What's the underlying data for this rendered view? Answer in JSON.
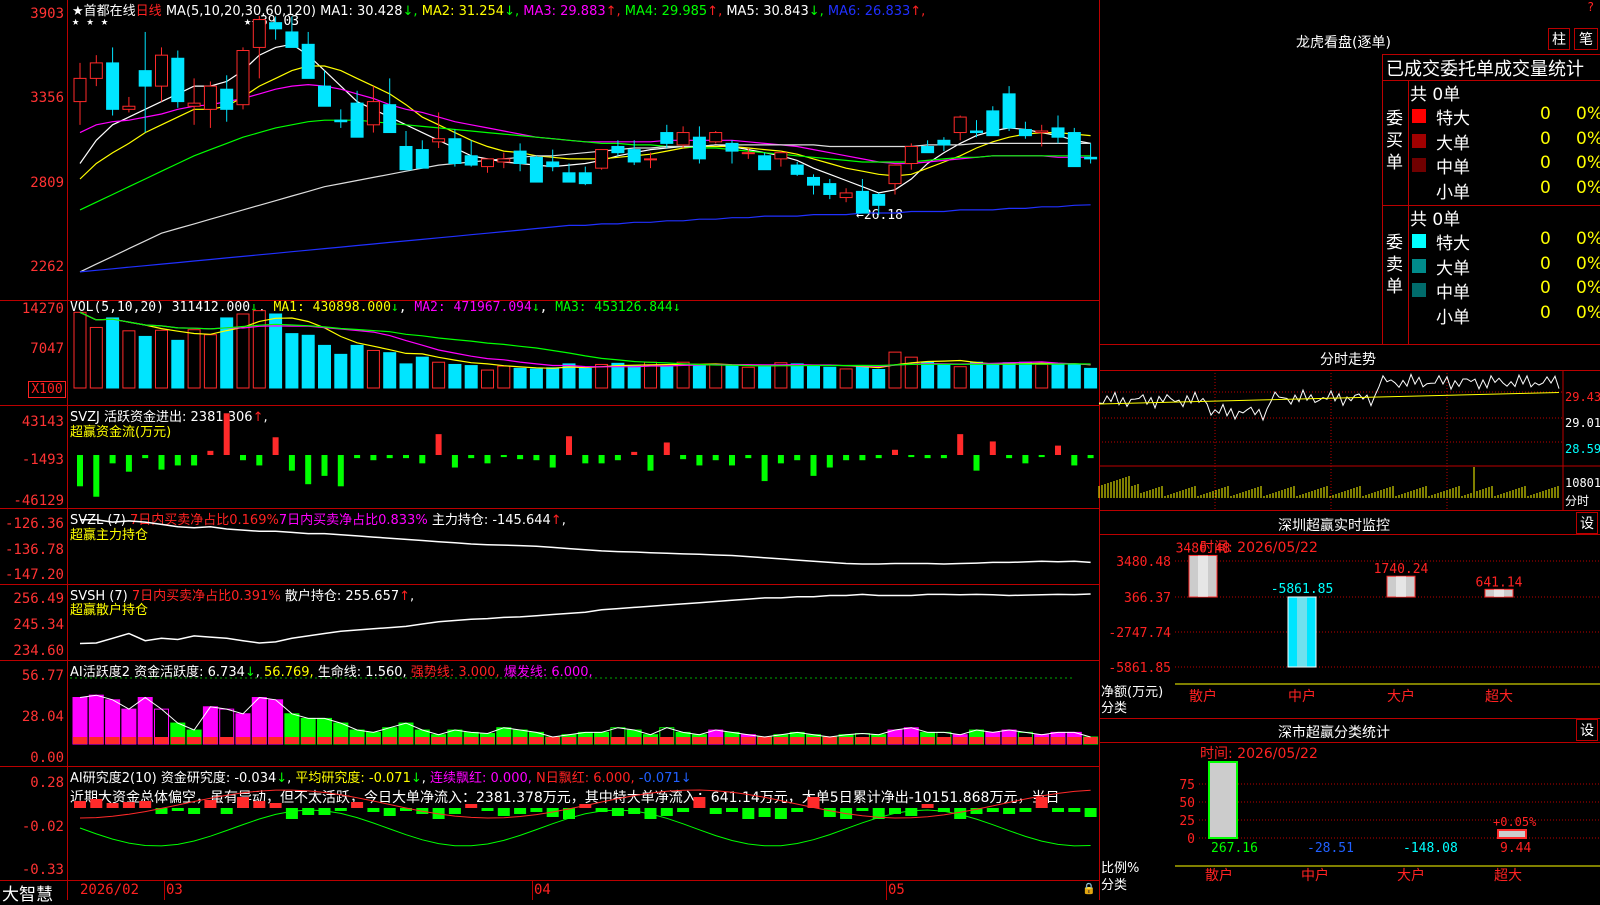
{
  "colors": {
    "up": "#ff2a2a",
    "down": "#00e5ff",
    "green": "#00ff00",
    "magenta": "#ff00ff",
    "yellow": "#ffff00",
    "grid": "#b00000",
    "blue": "#2030ff"
  },
  "kline": {
    "name": "首都在线",
    "period": "日线",
    "ma_label": "MA(5,10,20,30,60,120)",
    "ma": [
      {
        "label": "MA1:",
        "value": "30.428",
        "arrow": "↓",
        "color": "#ffffff"
      },
      {
        "label": "MA2:",
        "value": "31.254",
        "arrow": "↓",
        "color": "#ffff00"
      },
      {
        "label": "MA3:",
        "value": "29.883",
        "arrow": "↑",
        "color": "#ff00ff"
      },
      {
        "label": "MA4:",
        "value": "29.985",
        "arrow": "↑",
        "color": "#00ff00"
      },
      {
        "label": "MA5:",
        "value": "30.843",
        "arrow": "↓",
        "color": "#ffffff"
      },
      {
        "label": "MA6:",
        "value": "26.833",
        "arrow": "↑",
        "color": "#2030ff"
      }
    ],
    "yticks": [
      "3903",
      "3356",
      "2809",
      "2262"
    ],
    "high_label": "39.03",
    "low_label": "←26.18",
    "candles": [
      [
        33.5,
        36,
        32,
        35
      ],
      [
        35,
        36.5,
        34.5,
        36
      ],
      [
        36,
        37,
        32.6,
        33
      ],
      [
        33,
        33.8,
        32.8,
        33.2
      ],
      [
        35.5,
        38,
        31.5,
        34.5
      ],
      [
        34.5,
        37,
        33.5,
        36.5
      ],
      [
        36.3,
        36.8,
        33.1,
        33.5
      ],
      [
        33.2,
        35,
        32,
        33.4
      ],
      [
        33,
        34.8,
        31.8,
        34.5
      ],
      [
        34.3,
        35.2,
        32.2,
        33
      ],
      [
        33.3,
        37,
        33,
        36.8
      ],
      [
        37,
        39.03,
        35,
        38.8
      ],
      [
        38.6,
        39,
        37.5,
        38.2
      ],
      [
        38,
        39,
        37.5,
        37
      ],
      [
        37.2,
        38,
        35,
        35
      ],
      [
        34.5,
        35.5,
        33.5,
        33.2
      ],
      [
        32.3,
        33,
        31.8,
        32.2
      ],
      [
        33.4,
        34.2,
        31.8,
        31.2
      ],
      [
        32,
        34.5,
        31.5,
        33.5
      ],
      [
        33.3,
        35,
        31.8,
        31.5
      ],
      [
        30.6,
        31.6,
        29.5,
        29.1
      ],
      [
        30.4,
        31,
        29.3,
        29.2
      ],
      [
        30.9,
        32.8,
        30.5,
        31.1
      ],
      [
        31.1,
        31.7,
        29.3,
        29.5
      ],
      [
        30,
        31,
        29.3,
        29.4
      ],
      [
        29.3,
        29.8,
        28.9,
        29.8
      ],
      [
        29.6,
        30.2,
        29.2,
        29.8
      ],
      [
        30.3,
        30.8,
        29,
        29.5
      ],
      [
        29.9,
        30,
        28.3,
        28.3
      ],
      [
        29.6,
        30.4,
        29,
        29.3
      ],
      [
        28.9,
        29.5,
        28.7,
        28.3
      ],
      [
        28.9,
        29.3,
        28.1,
        28.2
      ],
      [
        29.2,
        30.4,
        29.1,
        30.4
      ],
      [
        30.6,
        31,
        30,
        30.2
      ],
      [
        30.4,
        31,
        29.4,
        29.6
      ],
      [
        29.8,
        30.2,
        29.2,
        29.8
      ],
      [
        31.5,
        32,
        30.5,
        30.8
      ],
      [
        30.7,
        31.9,
        30.5,
        31.5
      ],
      [
        31.2,
        31.9,
        29.5,
        29.8
      ],
      [
        30.9,
        31.6,
        30.8,
        31.5
      ],
      [
        30.8,
        31,
        29.5,
        30.3
      ],
      [
        30.2,
        30.5,
        29.8,
        30.2
      ],
      [
        30,
        30.2,
        29.1,
        29.1
      ],
      [
        29.8,
        30.3,
        29.3,
        30.2
      ],
      [
        29.4,
        29.6,
        28.7,
        28.8
      ],
      [
        28.6,
        28.8,
        27.5,
        28.1
      ],
      [
        28.2,
        28.5,
        27.2,
        27.5
      ],
      [
        27.3,
        27.9,
        27,
        27.6
      ],
      [
        27.7,
        28.5,
        26.5,
        26.3
      ],
      [
        27.5,
        27.6,
        26.18,
        26.8
      ],
      [
        28.2,
        29,
        27.5,
        29.4
      ],
      [
        29.5,
        30.8,
        29.1,
        30.6
      ],
      [
        30.6,
        31,
        30.2,
        30.2
      ],
      [
        31,
        31.2,
        30.3,
        30.7
      ],
      [
        31.5,
        32.6,
        31,
        32.5
      ],
      [
        31.6,
        32.3,
        31.2,
        31.5
      ],
      [
        32.9,
        33.2,
        32,
        31.3
      ],
      [
        34,
        34.5,
        31.6,
        31.8
      ],
      [
        31.7,
        32.2,
        31.1,
        31.3
      ],
      [
        31.5,
        32,
        30.6,
        31.6
      ],
      [
        31.8,
        32.6,
        30.8,
        31.2
      ],
      [
        31.5,
        31.8,
        29.4,
        29.3
      ],
      [
        29.9,
        30.8,
        29.5,
        29.8
      ]
    ],
    "ma_series": {
      "white": [
        29.5,
        31,
        32,
        32.5,
        33,
        33.5,
        34,
        34.5,
        34.5,
        34.8,
        35.5,
        36.5,
        37,
        37.2,
        36.5,
        35.5,
        34.5,
        33.5,
        33,
        32.5,
        32,
        31.5,
        31,
        30.5,
        30,
        29.8,
        29.6,
        29.5,
        29.4,
        29.3,
        29.4,
        29.5,
        29.7,
        30,
        30.2,
        30.4,
        30.5,
        30.6,
        30.6,
        30.7,
        30.6,
        30.4,
        30.2,
        30,
        29.7,
        29.2,
        28.8,
        28.4,
        28,
        27.6,
        27.8,
        28.5,
        29.5,
        30.2,
        30.8,
        31.3,
        31.6,
        31.8,
        31.7,
        31.5,
        31.3,
        31,
        30.8
      ],
      "yellow": [
        28.5,
        29.5,
        30.2,
        30.8,
        31.5,
        32,
        32.5,
        33,
        33,
        33.2,
        33.8,
        34.5,
        35,
        35.5,
        35.8,
        35.8,
        35.5,
        35,
        34.5,
        34,
        33.3,
        32.5,
        32,
        31.5,
        31,
        30.6,
        30.3,
        30.2,
        30,
        29.9,
        29.8,
        29.8,
        29.8,
        29.9,
        30,
        30.1,
        30.3,
        30.5,
        30.6,
        30.6,
        30.6,
        30.5,
        30.4,
        30.3,
        30.1,
        29.8,
        29.5,
        29.2,
        29,
        28.8,
        28.7,
        28.8,
        29.2,
        29.6,
        30,
        30.5,
        30.9,
        31.2,
        31.4,
        31.5,
        31.5,
        31.4,
        31.3
      ],
      "magenta": [
        31.5,
        32,
        32.2,
        32.3,
        32.5,
        32.7,
        33,
        33.2,
        33.3,
        33.5,
        33.7,
        34,
        34.3,
        34.5,
        34.6,
        34.5,
        34.3,
        34,
        33.7,
        33.3,
        33,
        32.8,
        32.5,
        32.2,
        32,
        31.8,
        31.6,
        31.4,
        31.2,
        31.1,
        31,
        30.9,
        30.9,
        30.9,
        30.9,
        30.9,
        31,
        31,
        31,
        31,
        31,
        30.9,
        30.8,
        30.7,
        30.6,
        30.4,
        30.2,
        30,
        29.8,
        29.6,
        29.5,
        29.5,
        29.6,
        29.7,
        29.8,
        29.9,
        30,
        30,
        30,
        30,
        29.9,
        29.9,
        29.9
      ],
      "green": [
        26.5,
        27,
        27.5,
        28,
        28.5,
        29,
        29.5,
        30,
        30.4,
        30.8,
        31.2,
        31.5,
        31.8,
        32,
        32.2,
        32.3,
        32.3,
        32.3,
        32.2,
        32.1,
        32,
        31.9,
        31.8,
        31.7,
        31.6,
        31.5,
        31.4,
        31.3,
        31.2,
        31.1,
        31,
        30.9,
        30.8,
        30.8,
        30.7,
        30.7,
        30.6,
        30.6,
        30.5,
        30.5,
        30.4,
        30.3,
        30.2,
        30.1,
        30,
        29.9,
        29.8,
        29.7,
        29.6,
        29.6,
        29.6,
        29.6,
        29.7,
        29.8,
        29.9,
        29.9,
        30,
        30,
        30,
        30,
        30,
        30,
        30
      ],
      "white2": [
        22.5,
        23,
        23.5,
        24,
        24.5,
        25,
        25.3,
        25.6,
        25.9,
        26.2,
        26.5,
        26.8,
        27.1,
        27.4,
        27.7,
        28,
        28.2,
        28.4,
        28.6,
        28.8,
        29,
        29.2,
        29.4,
        29.5,
        29.6,
        29.7,
        29.8,
        29.9,
        30,
        30,
        30.1,
        30.2,
        30.3,
        30.4,
        30.5,
        30.5,
        30.6,
        30.6,
        30.6,
        30.7,
        30.7,
        30.7,
        30.7,
        30.7,
        30.7,
        30.7,
        30.6,
        30.6,
        30.6,
        30.6,
        30.6,
        30.6,
        30.7,
        30.7,
        30.7,
        30.8,
        30.8,
        30.8,
        30.8,
        30.8,
        30.8,
        30.8,
        30.8
      ],
      "blue": [
        22.5,
        22.6,
        22.7,
        22.8,
        22.9,
        23,
        23.1,
        23.2,
        23.3,
        23.4,
        23.5,
        23.6,
        23.7,
        23.8,
        23.9,
        24,
        24.1,
        24.2,
        24.3,
        24.4,
        24.5,
        24.6,
        24.7,
        24.8,
        24.9,
        25,
        25.1,
        25.2,
        25.3,
        25.4,
        25.5,
        25.5,
        25.6,
        25.6,
        25.7,
        25.7,
        25.8,
        25.8,
        25.9,
        25.9,
        26,
        26,
        26.1,
        26.1,
        26.1,
        26.2,
        26.2,
        26.2,
        26.3,
        26.3,
        26.3,
        26.4,
        26.4,
        26.4,
        26.5,
        26.5,
        26.5,
        26.6,
        26.6,
        26.7,
        26.7,
        26.8,
        26.833
      ]
    }
  },
  "volume": {
    "label": "VOL(5,10,20)",
    "value": "311412.000",
    "value_arrow": "↓",
    "ma1": "MA1: 430898.000",
    "ma1_arrow": "↓",
    "ma2": "MA2: 471967.094",
    "ma2_arrow": "↓",
    "ma3": "MA3: 453126.844",
    "ma3_arrow": "↓",
    "yticks": [
      "14270",
      "7047"
    ],
    "unit": "X100",
    "values": [
      13500,
      10800,
      12500,
      10200,
      9200,
      10300,
      8500,
      10400,
      9500,
      12500,
      13200,
      13800,
      13200,
      9700,
      9400,
      7600,
      6000,
      7600,
      6700,
      6300,
      4300,
      5500,
      4600,
      4200,
      4000,
      3200,
      3900,
      3500,
      3400,
      3600,
      4300,
      3500,
      4200,
      4400,
      3900,
      4600,
      3800,
      4600,
      4200,
      4200,
      4000,
      3700,
      3800,
      4500,
      4300,
      4000,
      3700,
      3400,
      3800,
      3300,
      6400,
      5500,
      4600,
      4200,
      3800,
      4600,
      4200,
      4500,
      4600,
      4200,
      4200,
      4200,
      3500
    ]
  },
  "svzj": {
    "line1": "SVZJ   活跃资金进出: 2381.306",
    "arrow": "↑",
    "subtitle": "超赢资金流(万元)",
    "yticks": [
      "43143",
      "-1493",
      "-46129"
    ],
    "bars": [
      -30000,
      -40000,
      -8000,
      -16000,
      -3000,
      -14000,
      -10000,
      -10000,
      4000,
      40000,
      -5000,
      -10000,
      17000,
      -15000,
      -28000,
      -20000,
      -30000,
      -3000,
      -5000,
      -3000,
      -3000,
      -8000,
      20000,
      -12000,
      -3000,
      -8000,
      -2000,
      -4000,
      -5000,
      -12000,
      18000,
      -8000,
      -8000,
      -5000,
      3000,
      -15000,
      12000,
      -4000,
      -10000,
      -5000,
      -10000,
      -3000,
      -25000,
      -8000,
      -5000,
      -20000,
      -12000,
      -5000,
      -5000,
      -3000,
      5000,
      -2000,
      -3000,
      -3000,
      20000,
      -15000,
      13000,
      -3000,
      -8000,
      -2000,
      9000,
      -10000,
      -3000
    ]
  },
  "svzl": {
    "text": "SVZL (7) ",
    "pct_label": "7日内买卖净占比0.169%",
    "pct2_label": "7日内买卖净占比0.833%",
    "holding": "主力持仓: -145.644",
    "holding_arrow": "↑",
    "subtitle": "超赢主力持仓",
    "yticks": [
      "-126.36",
      "-136.78",
      "-147.20"
    ],
    "values": [
      -128,
      -128,
      -129,
      -128.5,
      -129,
      -130,
      -131,
      -131.5,
      -131,
      -132,
      -132.5,
      -133,
      -133,
      -133.5,
      -134,
      -134,
      -134.5,
      -135,
      -135.5,
      -136,
      -136.5,
      -137,
      -137.5,
      -138,
      -138.5,
      -138.8,
      -139,
      -139.2,
      -139.5,
      -140,
      -140.5,
      -141,
      -141.5,
      -141.8,
      -142,
      -142.3,
      -142.5,
      -142.8,
      -143,
      -143.3,
      -143.5,
      -144,
      -144.5,
      -145,
      -145.5,
      -146,
      -146.5,
      -147,
      -147.2,
      -147.2,
      -147,
      -147,
      -147,
      -147.2,
      -147,
      -146.8,
      -146.5,
      -146.5,
      -146.3,
      -146,
      -146.2,
      -146,
      -146.5
    ]
  },
  "svsh": {
    "text": "SVSH (7) ",
    "pct_label": "7日内买卖净占比0.391%",
    "holding": "散户持仓: 255.657",
    "holding_arrow": "↑",
    "subtitle": "超赢散户持仓",
    "yticks": [
      "256.49",
      "245.34",
      "234.60"
    ],
    "values": [
      234.8,
      235,
      237,
      239,
      236,
      237,
      236.5,
      238,
      237.5,
      237,
      236,
      235,
      235.5,
      237,
      238,
      239,
      240,
      240.5,
      241,
      241.5,
      242,
      243,
      244,
      244.5,
      245,
      245.3,
      245.8,
      246,
      246.5,
      247,
      247.5,
      248,
      249,
      249.5,
      250,
      250.5,
      251,
      251.5,
      252,
      252.5,
      253,
      253.5,
      254,
      254,
      254.5,
      254.5,
      255,
      255,
      255.5,
      255,
      255,
      255,
      255.5,
      255.5,
      255.3,
      255.5,
      255.3,
      255,
      255.2,
      255.3,
      255.5,
      255.4,
      255.65
    ]
  },
  "ai_activity": {
    "label": "AI活跃度2 资金活跃度: 6.734",
    "arrow1": "↓",
    "v2": "56.769,",
    "v3": "生命线: 1.560,",
    "strong": "强势线: 3.000,",
    "burst": "爆发线: 6.000,",
    "yticks": [
      "56.77",
      "28.04",
      "0.00"
    ],
    "bars": [
      40,
      42,
      38,
      30,
      40,
      30,
      18,
      12,
      32,
      30,
      26,
      40,
      38,
      26,
      22,
      22,
      18,
      12,
      10,
      14,
      18,
      12,
      8,
      12,
      10,
      9,
      14,
      12,
      10,
      6,
      8,
      10,
      10,
      14,
      12,
      8,
      14,
      10,
      8,
      12,
      10,
      8,
      6,
      8,
      10,
      8,
      6,
      8,
      9,
      8,
      12,
      14,
      10,
      10,
      8,
      12,
      10,
      12,
      10,
      8,
      10,
      10,
      6
    ],
    "kinds": [
      "m",
      "m",
      "m",
      "m",
      "m",
      "mh",
      "g",
      "g",
      "m",
      "mh",
      "m",
      "m",
      "m",
      "g",
      "g",
      "g",
      "g",
      "g",
      "g",
      "g",
      "g",
      "g",
      "g",
      "g",
      "g",
      "g",
      "g",
      "g",
      "g",
      "g",
      "g",
      "g",
      "g",
      "gh",
      "g",
      "g",
      "gh",
      "g",
      "g",
      "m",
      "g",
      "m",
      "g",
      "g",
      "g",
      "g",
      "g",
      "g",
      "gh",
      "g",
      "m",
      "m",
      "g",
      "gh",
      "m",
      "g",
      "m",
      "m",
      "gh",
      "m",
      "m",
      "m",
      "g"
    ]
  },
  "ai_research": {
    "label": "AI研究度2(10) 资金研究度: -0.034",
    "arrow1": "↓",
    "avg": "平均研究度: -0.071",
    "arrow2": "↓",
    "red": "连续飘红: 0.000,",
    "n": "N日飘红: 6.000,",
    "last": "-0.071",
    "yticks": [
      "0.28",
      "-0.02",
      "-0.33"
    ],
    "comment": "近期大资金总体偏空，虽有异动，但不太活跃，今日大单净流入：2381.378万元，其中特大单净流入：641.14万元，大单5日累计净出-10151.868万元，当日"
  },
  "xaxis": {
    "brand": "大智慧",
    "labels": [
      "2026/02",
      "03",
      "04",
      "05"
    ]
  },
  "right": {
    "title": "龙虎看盘(逐单)",
    "btn_bar": "柱",
    "btn_pen": "笔",
    "stat_header": "已成交委托单成交量统计",
    "buy": {
      "side": "委买单",
      "total": "共 0单",
      "rows": [
        [
          "特大",
          "0",
          "0%",
          "#ff0000"
        ],
        [
          "大单",
          "0",
          "0%",
          "#a00000"
        ],
        [
          "中单",
          "0",
          "0%",
          "#700000"
        ],
        [
          "小单",
          "0",
          "0%",
          "#000000"
        ]
      ]
    },
    "sell": {
      "side": "委卖单",
      "total": "共 0单",
      "rows": [
        [
          "特大",
          "0",
          "0%",
          "#00ffff"
        ],
        [
          "大单",
          "0",
          "0%",
          "#008b8b"
        ],
        [
          "中单",
          "0",
          "0%",
          "#006b6b"
        ],
        [
          "小单",
          "0",
          "0%",
          "#000000"
        ]
      ]
    },
    "intraday": {
      "title": "分时走势",
      "yticks": [
        "29.43",
        "29.01",
        "28.59"
      ],
      "vol_label": "10801",
      "vol_label2": "分时"
    },
    "sz_monitor": {
      "title": "深圳超赢实时监控",
      "set": "设",
      "time": "时间: 2026/05/22",
      "yticks": [
        "3480.48",
        "366.37",
        "-2747.74",
        "-5861.85"
      ],
      "cats": [
        "散户",
        "中户",
        "大户",
        "超大"
      ],
      "values": [
        3480.48,
        -5861.85,
        1740.24,
        641.14
      ],
      "vlabels": [
        "3480.48",
        "-5861.85",
        "1740.24",
        "641.14"
      ],
      "ylabel": "净额(万元)",
      "xlabel": "分类"
    },
    "sz_class": {
      "title": "深市超赢分类统计",
      "set": "设",
      "time": "时间: 2026/05/22",
      "yticks": [
        "75",
        "50",
        "25",
        "0"
      ],
      "cats": [
        "散户",
        "中户",
        "大户",
        "超大"
      ],
      "values": [
        267.16,
        -28.51,
        -148.08,
        9.44
      ],
      "vlabels": [
        "267.16",
        "-28.51",
        "-148.08",
        "9.44"
      ],
      "pct_label": "+0.05%",
      "ylabel": "比例%",
      "xlabel": "分类"
    }
  }
}
